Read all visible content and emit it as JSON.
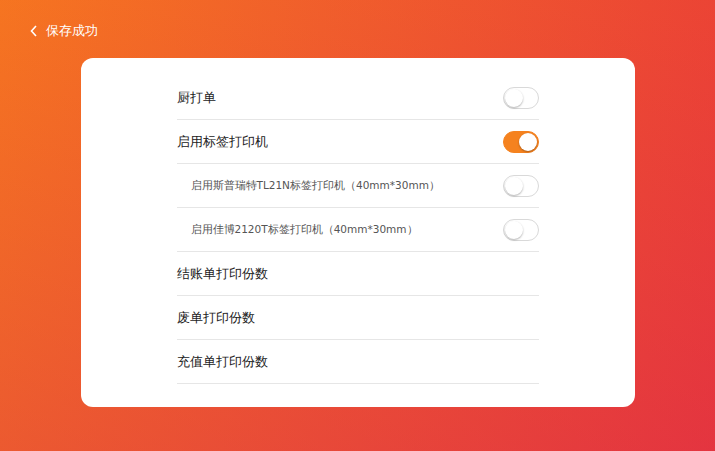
{
  "header": {
    "back_label": "保存成功"
  },
  "settings": [
    {
      "label": "厨打单",
      "kind": "toggle",
      "on": false
    },
    {
      "label": "启用标签打印机",
      "kind": "toggle",
      "on": true
    },
    {
      "label": "启用斯普瑞特TL21N标签打印机（40mm*30mm）",
      "kind": "sub-toggle",
      "on": false
    },
    {
      "label": "启用佳博2120T标签打印机（40mm*30mm）",
      "kind": "sub-toggle",
      "on": false
    },
    {
      "label": "结账单打印份数",
      "kind": "plain"
    },
    {
      "label": "废单打印份数",
      "kind": "plain"
    },
    {
      "label": "充值单打印份数",
      "kind": "plain"
    }
  ]
}
